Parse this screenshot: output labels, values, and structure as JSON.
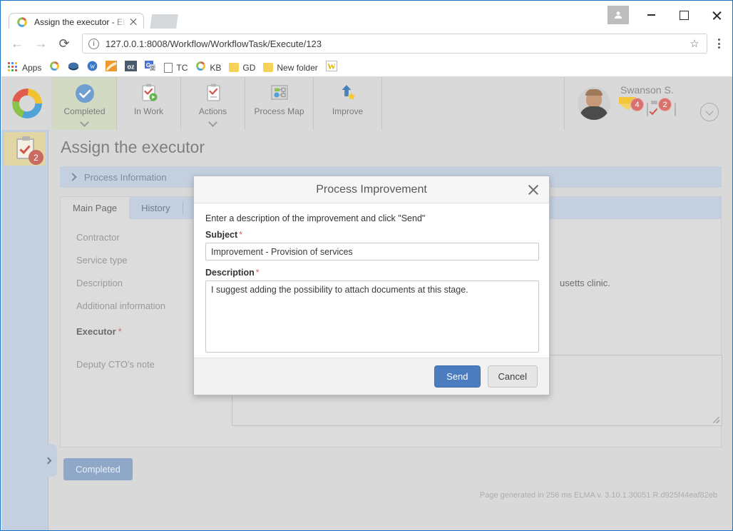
{
  "browser": {
    "tab": {
      "title": "Assign the executor - ELM",
      "favicon": "elma-ring-icon",
      "close": "×"
    },
    "nav": {
      "back": "←",
      "forward": "→",
      "reload": "⟳"
    },
    "address": {
      "value": "127.0.0.1:8008/Workflow/WorkflowTask/Execute/123",
      "info_glyph": "i",
      "star": "☆"
    },
    "window": {
      "minimize": "—",
      "maximize": "□",
      "close": "✕"
    },
    "bookmarks": [
      {
        "label": "Apps",
        "icon": "apps-grid-icon"
      },
      {
        "label": "",
        "icon": "elma-ring-icon"
      },
      {
        "label": "",
        "icon": "blue-gem-icon"
      },
      {
        "label": "",
        "icon": "w-circle-icon"
      },
      {
        "label": "",
        "icon": "orange-fan-icon"
      },
      {
        "label": "",
        "icon": "oz-icon"
      },
      {
        "label": "",
        "icon": "google-translate-icon"
      },
      {
        "label": "TC",
        "icon": "document-icon"
      },
      {
        "label": "KB",
        "icon": "elma-ring-icon"
      },
      {
        "label": "GD",
        "icon": "folder-icon"
      },
      {
        "label": "New folder",
        "icon": "folder-icon"
      },
      {
        "label": "",
        "icon": "w-letter-icon"
      }
    ]
  },
  "toolbar": {
    "logo": "elma-ring-logo",
    "items": [
      {
        "label": "Completed",
        "icon": "check-circle-icon",
        "active": true,
        "caret": true
      },
      {
        "label": "In Work",
        "icon": "clipboard-play-icon",
        "active": false,
        "caret": false
      },
      {
        "label": "Actions",
        "icon": "clipboard-check-icon",
        "active": false,
        "caret": true
      },
      {
        "label": "Process Map",
        "icon": "process-map-icon",
        "active": false,
        "caret": false
      },
      {
        "label": "Improve",
        "icon": "arrow-up-star-icon",
        "active": false,
        "caret": false
      }
    ],
    "user": {
      "name": "Swanson S.",
      "avatar": "user-avatar",
      "mail_badge": "4",
      "tasks_badge": "2",
      "calendar_icon": "calendar-icon",
      "menu_icon": "chevron-down-circle-icon"
    }
  },
  "sidebar": {
    "tab_icon": "clipboard-check-icon",
    "tab_badge": "2",
    "expand_handle": "chevron-right-icon"
  },
  "main": {
    "page_title": "Assign the executor",
    "process_information": {
      "label": "Process Information",
      "arrow": "chevron-right-icon"
    },
    "tabs": [
      {
        "label": "Main Page",
        "selected": true
      },
      {
        "label": "History",
        "selected": false
      }
    ],
    "fields": [
      {
        "label": "Contractor",
        "required": false,
        "value": ""
      },
      {
        "label": "Service type",
        "required": false,
        "value": ""
      },
      {
        "label": "Description",
        "required": false,
        "value": "usetts clinic."
      },
      {
        "label": "Additional information",
        "required": false,
        "value": ""
      },
      {
        "label": "Executor",
        "required": true,
        "value": ""
      },
      {
        "label": "Deputy CTO's note",
        "required": false,
        "value": ""
      }
    ],
    "required_marker": "*",
    "completed_button": "Completed",
    "footer_note": "Page generated in 256 ms ELMA v. 3.10.1.30051 R.d925f44eaf82eb"
  },
  "modal": {
    "title": "Process Improvement",
    "close_icon": "close-icon",
    "intro": "Enter a description of the improvement and click \"Send\"",
    "subject": {
      "label": "Subject",
      "required_marker": "*",
      "value": "Improvement - Provision of services"
    },
    "description": {
      "label": "Description",
      "required_marker": "*",
      "value": "I suggest adding the possibility to attach documents at this stage."
    },
    "buttons": {
      "send": "Send",
      "cancel": "Cancel"
    }
  },
  "colors": {
    "accent_blue": "#4a7cbf",
    "badge_red": "#d9726c",
    "rail_blue": "#c4d0e0",
    "active_tab_green": "#d3dac3",
    "required_star": "#cf6666"
  }
}
